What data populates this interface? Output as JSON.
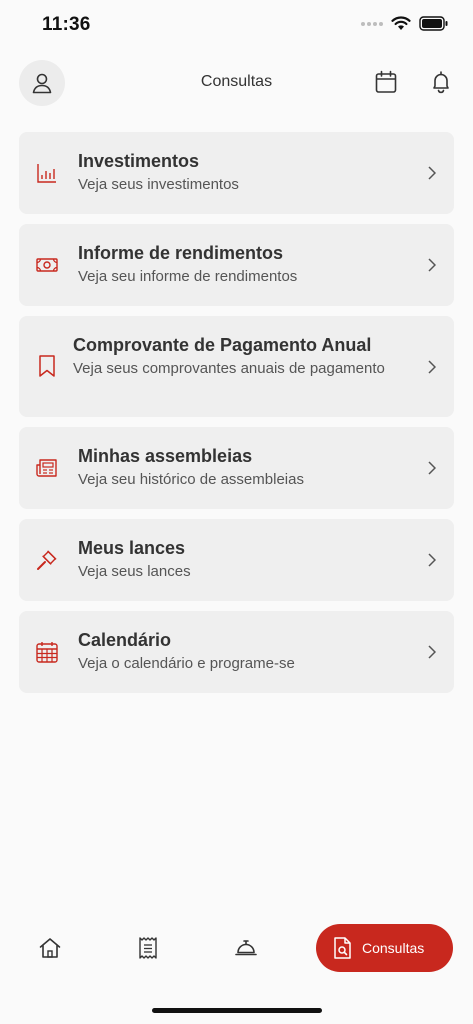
{
  "status": {
    "time": "11:36"
  },
  "header": {
    "title": "Consultas"
  },
  "menu": [
    {
      "title": "Investimentos",
      "subtitle": "Veja seus investimentos",
      "icon": "bar-chart-icon"
    },
    {
      "title": "Informe de rendimentos",
      "subtitle": "Veja seu informe de rendimentos",
      "icon": "money-bill-icon"
    },
    {
      "title": "Comprovante de Pagamento Anual",
      "subtitle": "Veja seus comprovantes anuais de pagamento",
      "icon": "bookmark-icon"
    },
    {
      "title": "Minhas assembleias",
      "subtitle": "Veja seu histórico de assembleias",
      "icon": "newspaper-icon"
    },
    {
      "title": "Meus lances",
      "subtitle": "Veja seus lances",
      "icon": "gavel-icon"
    },
    {
      "title": "Calendário",
      "subtitle": "Veja o calendário e programe-se",
      "icon": "calendar-icon"
    }
  ],
  "bottom_nav": {
    "active_label": "Consultas"
  },
  "colors": {
    "accent": "#c8281e",
    "card_bg": "#efefef",
    "page_bg": "#fafafa"
  }
}
